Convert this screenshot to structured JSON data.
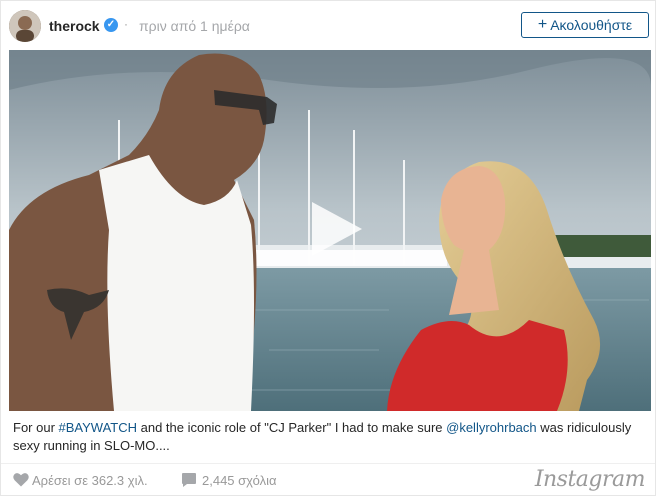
{
  "header": {
    "username": "therock",
    "separator": "·",
    "timestamp": "πριν από 1 ημέρα",
    "follow_plus": "+",
    "follow_label": "Ακολουθήστε"
  },
  "media": {
    "type": "video",
    "icon": "play-icon"
  },
  "caption": {
    "text_1": "For our ",
    "hashtag": "#BAYWATCH",
    "text_2": " and the iconic role of \"CJ Parker\" I had to make sure ",
    "mention": "@kellyrohrbach",
    "text_3": " was ridiculously sexy running in SLO-MO...."
  },
  "footer": {
    "likes": "Αρέσει σε 362.3 χιλ.",
    "comments": "2,445 σχόλια",
    "brand": "Instagram"
  },
  "colors": {
    "link": "#125688",
    "verified": "#3897f0",
    "muted": "#999999"
  }
}
